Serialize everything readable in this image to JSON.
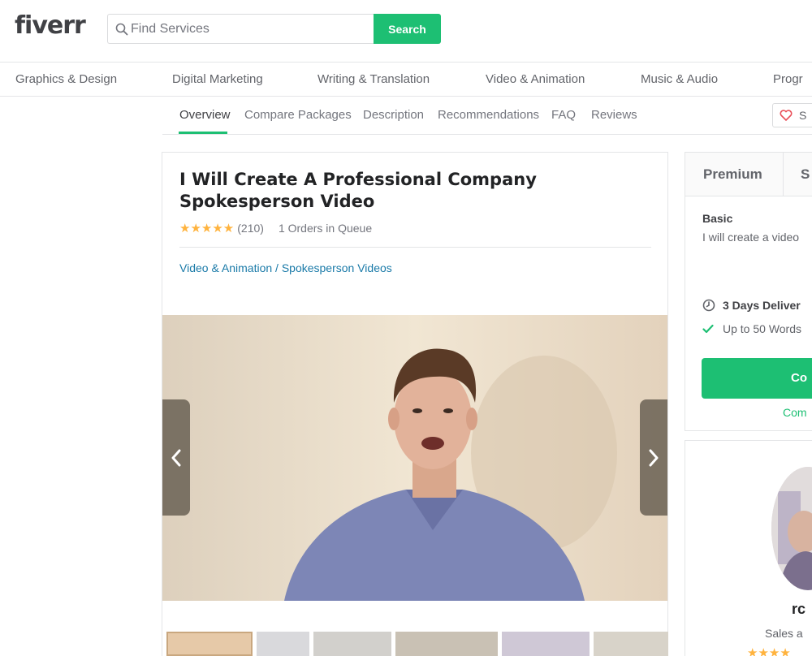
{
  "header": {
    "logo": "fiverr",
    "search_placeholder": "Find Services",
    "search_button": "Search"
  },
  "categories": [
    "Graphics & Design",
    "Digital Marketing",
    "Writing & Translation",
    "Video & Animation",
    "Music & Audio",
    "Progr"
  ],
  "subnav": {
    "tabs": [
      "Overview",
      "Compare Packages",
      "Description",
      "Recommendations",
      "FAQ",
      "Reviews"
    ],
    "active": "Overview",
    "save_label": "S"
  },
  "gig": {
    "title": "I Will Create A Professional Company Spokesperson Video",
    "stars": "★★★★★",
    "rating_count": "(210)",
    "queue": "1 Orders in Queue",
    "breadcrumb_category": "Video & Animation",
    "breadcrumb_sep": " / ",
    "breadcrumb_subcategory": "Spokesperson Videos"
  },
  "package": {
    "tab_premium": "Premium",
    "tab_partial": "S",
    "name": "Basic",
    "description": "I will create a video",
    "delivery": "3 Days Deliver",
    "feature": "Up to 50 Words",
    "button": "Co",
    "compare": "Com"
  },
  "seller": {
    "name": "rc",
    "role": "Sales a",
    "stars": "★★★★"
  },
  "colors": {
    "brand_green": "#1dbf73",
    "star": "#ffb33e",
    "link": "#1a7aa8"
  }
}
